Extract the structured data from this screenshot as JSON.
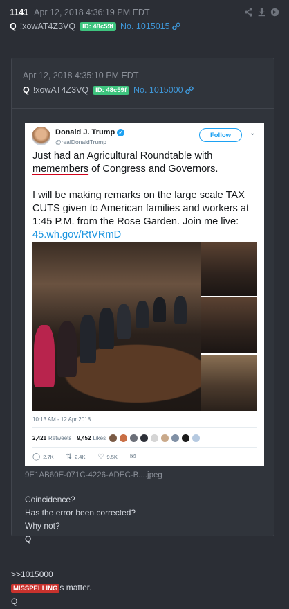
{
  "post": {
    "number": "1141",
    "date": "Apr 12, 2018 4:36:19 PM EDT",
    "name": "Q",
    "tripcode": "!xowAT4Z3VQ",
    "id_badge": "ID: 48c59f",
    "post_link": "No. 1015015",
    "icons": [
      "share-icon",
      "download-icon",
      "refresh-icon",
      "link-icon"
    ]
  },
  "quoted": {
    "date": "Apr 12, 2018 4:35:10 PM EDT",
    "name": "Q",
    "tripcode": "!xowAT4Z3VQ",
    "id_badge": "ID: 48c59f",
    "post_link": "No. 1015000",
    "tweet": {
      "display_name": "Donald J. Trump",
      "handle": "@realDonaldTrump",
      "follow_label": "Follow",
      "text_line1_a": "Just had an Agricultural Roundtable with",
      "text_line1_b_misspelled": "memembers",
      "text_line1_c": " of Congress and Governors.",
      "text_para2": "I will be making remarks on the large scale TAX CUTS given to American families and workers at 1:45 P.M. from the Rose Garden. Join me live: ",
      "link": "45.wh.gov/RtVRmD",
      "timestamp": "10:13 AM - 12 Apr 2018",
      "retweets_count": "2,421",
      "retweets_label": "Retweets",
      "likes_count": "9,452",
      "likes_label": "Likes",
      "replies": "2.7K",
      "retweet_action": "2.4K",
      "like_action": "9.5K"
    },
    "filename": "9E1AB60E-071C-4226-ADEC-B....jpeg",
    "body_lines": [
      "Coincidence?",
      "Has the error been corrected?",
      "Why not?",
      "Q"
    ]
  },
  "reply": {
    "ref": ">>1015000",
    "highlight": "MISSPELLING",
    "after_highlight": "s matter.",
    "sign": "Q"
  },
  "colors": {
    "background": "#2b2e35",
    "link": "#3f97d8",
    "id_badge": "#3ec47e",
    "highlight": "#c8322d",
    "twitter_blue": "#1da1f2"
  }
}
